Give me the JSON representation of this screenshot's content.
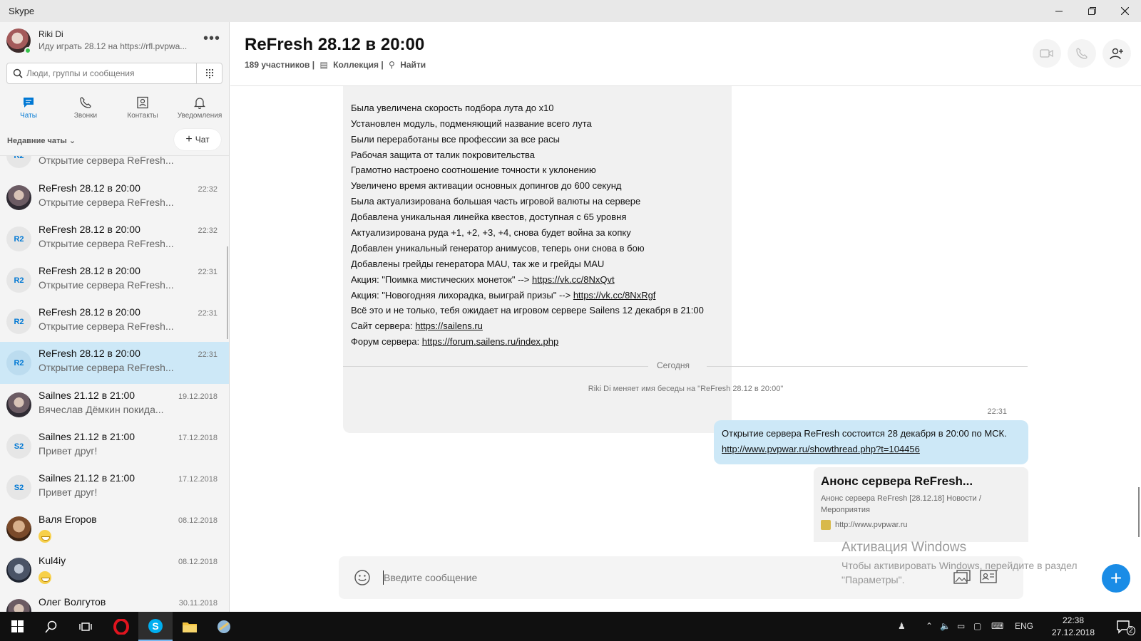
{
  "window": {
    "title": "Skype"
  },
  "profile": {
    "name": "Riki Di",
    "mood": "Иду играть 28.12 на https://rfl.pvpwa..."
  },
  "search": {
    "placeholder": "Люди, группы и сообщения"
  },
  "nav": [
    {
      "label": "Чаты",
      "icon": "chat-icon",
      "active": true
    },
    {
      "label": "Звонки",
      "icon": "phone-icon"
    },
    {
      "label": "Контакты",
      "icon": "contacts-icon"
    },
    {
      "label": "Уведомления",
      "icon": "bell-icon"
    }
  ],
  "recent_label": "Недавние чаты",
  "new_chat_label": "Чат",
  "chats": [
    {
      "initials": "R2",
      "title": "",
      "preview": "Открытие сервера ReFresh...",
      "time": ""
    },
    {
      "initials": "",
      "title": "ReFresh 28.12 в 20:00",
      "preview": "Открытие сервера ReFresh...",
      "time": "22:32"
    },
    {
      "initials": "R2",
      "title": "ReFresh 28.12 в 20:00",
      "preview": "Открытие сервера ReFresh...",
      "time": "22:32"
    },
    {
      "initials": "R2",
      "title": "ReFresh 28.12 в 20:00",
      "preview": "Открытие сервера ReFresh...",
      "time": "22:31"
    },
    {
      "initials": "R2",
      "title": "ReFresh 28.12 в 20:00",
      "preview": "Открытие сервера ReFresh...",
      "time": "22:31"
    },
    {
      "initials": "R2",
      "title": "ReFresh 28.12 в 20:00",
      "preview": "Открытие сервера ReFresh...",
      "time": "22:31",
      "selected": true
    },
    {
      "initials": "",
      "title": "Sailnes 21.12 в 21:00",
      "preview": "Вячеслав Дёмкин покида...",
      "time": "19.12.2018"
    },
    {
      "initials": "S2",
      "title": "Sailnes 21.12 в 21:00",
      "preview": "Привет друг!",
      "time": "17.12.2018"
    },
    {
      "initials": "S2",
      "title": "Sailnes 21.12 в 21:00",
      "preview": "Привет друг!",
      "time": "17.12.2018"
    },
    {
      "initials": "",
      "title": "Валя Егоров",
      "preview": "",
      "time": "08.12.2018",
      "emoji": true
    },
    {
      "initials": "",
      "title": "Kul4iy",
      "preview": "",
      "time": "08.12.2018",
      "emoji": true
    },
    {
      "initials": "",
      "title": "Олег Волгутов",
      "preview": "",
      "time": "30.11.2018"
    }
  ],
  "conversation": {
    "title": "ReFresh 28.12 в 20:00",
    "participants": "189 участников |",
    "collection": "Коллекция |",
    "find": "Найти"
  },
  "incoming_lines": [
    "",
    "Была увеличена скорость подбора лута до х10",
    "Установлен модуль, подменяющий название всего лута",
    "Были переработаны все профессии за все расы",
    "Рабочая защита от талик покровительства",
    "Грамотно настроено соотношение точности к уклонению",
    "Увеличено время активации основных допингов до 600 секунд",
    "Была актуализирована большая часть игровой валюты на сервере",
    "Добавлена уникальная линейка квестов, доступная с 65 уровня",
    "Актуализирована руда +1, +2, +3, +4, снова будет война за копку",
    "Добавлен уникальный генератор анимусов, теперь они снова в бою",
    "Добавлены грейды генератора MAU, так же и грейды MAU"
  ],
  "incoming_links": [
    {
      "prefix": "Акция: \"Поимка мистических монеток\" --> ",
      "link": "https://vk.cc/8NxQvt"
    },
    {
      "prefix": "Акция: \"Новогодняя лихорадка, выиграй призы\" --> ",
      "link": "https://vk.cc/8NxRgf"
    },
    {
      "prefix": "Всё это и не только, тебя ожидает на игровом сервере Sailens 12 декабря в 21:00",
      "link": ""
    },
    {
      "prefix": "Сайт сервера: ",
      "link": "https://sailens.ru"
    },
    {
      "prefix": "Форум сервера: ",
      "link": "https://forum.sailens.ru/index.php"
    }
  ],
  "divider_label": "Сегодня",
  "system_message": "Riki Di меняет имя беседы на \"ReFresh 28.12 в 20:00\"",
  "outgoing": {
    "time": "22:31",
    "text": "Открытие сервера ReFresh состоится 28 декабря в 20:00 по МСК.",
    "link": "http://www.pvpwar.ru/showthread.php?t=104456"
  },
  "link_preview": {
    "title": "Анонс сервера ReFresh...",
    "description": "Анонс сервера ReFresh [28.12.18] Новости / Мероприятия",
    "url": "http://www.pvpwar.ru"
  },
  "composer": {
    "placeholder": "Введите сообщение"
  },
  "watermark": {
    "title": "Активация Windows",
    "text": "Чтобы активировать Windows, перейдите в раздел \"Параметры\"."
  },
  "taskbar": {
    "lang": "ENG",
    "time": "22:38",
    "date": "27.12.2018",
    "notifications": "2"
  },
  "colors": {
    "accent": "#0078d4",
    "selected": "#cde8f7",
    "fab": "#1a8ce6"
  }
}
